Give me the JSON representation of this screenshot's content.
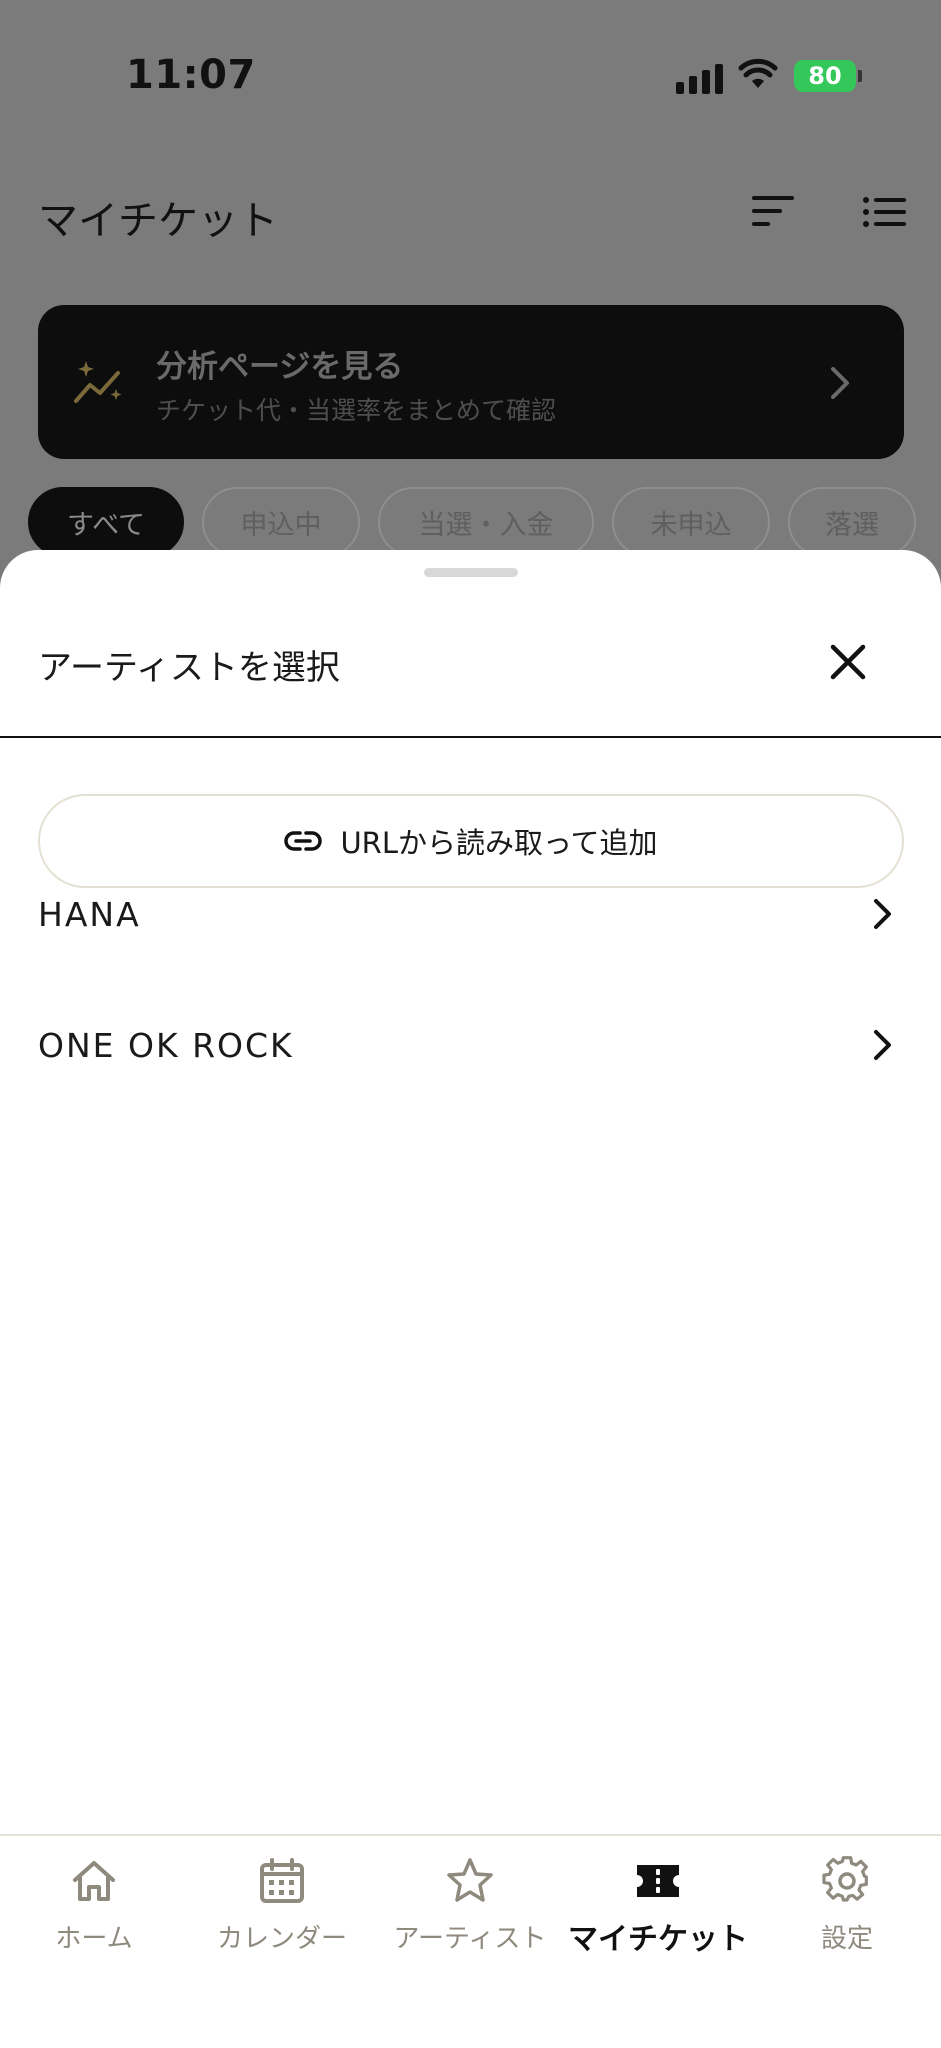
{
  "status_bar": {
    "time": "11:07",
    "battery": "80"
  },
  "header": {
    "title": "マイチケット",
    "sort_icon": "sort-icon",
    "list_icon": "list-icon"
  },
  "banner": {
    "title": "分析ページを見る",
    "subtitle": "チケット代・当選率をまとめて確認",
    "icon": "sparkle-chart-icon"
  },
  "filters": [
    {
      "label": "すべて",
      "active": true
    },
    {
      "label": "申込中",
      "active": false
    },
    {
      "label": "当選・入金",
      "active": false
    },
    {
      "label": "未申込",
      "active": false
    },
    {
      "label": "落選",
      "active": false
    }
  ],
  "sheet": {
    "title": "アーティストを選択",
    "url_button_label": "URLから読み取って追加",
    "artists": [
      {
        "name": "HANA"
      },
      {
        "name": "ONE OK ROCK"
      }
    ]
  },
  "tabbar": {
    "tabs": [
      {
        "label": "ホーム",
        "icon": "home-icon",
        "active": false
      },
      {
        "label": "カレンダー",
        "icon": "calendar-icon",
        "active": false
      },
      {
        "label": "アーティスト",
        "icon": "star-icon",
        "active": false
      },
      {
        "label": "マイチケット",
        "icon": "ticket-icon",
        "active": true
      },
      {
        "label": "設定",
        "icon": "gear-icon",
        "active": false
      }
    ]
  },
  "colors": {
    "accent_gold": "#7a6a3a",
    "dim_overlay": "#7b7b7b",
    "battery_green": "#34c759"
  }
}
